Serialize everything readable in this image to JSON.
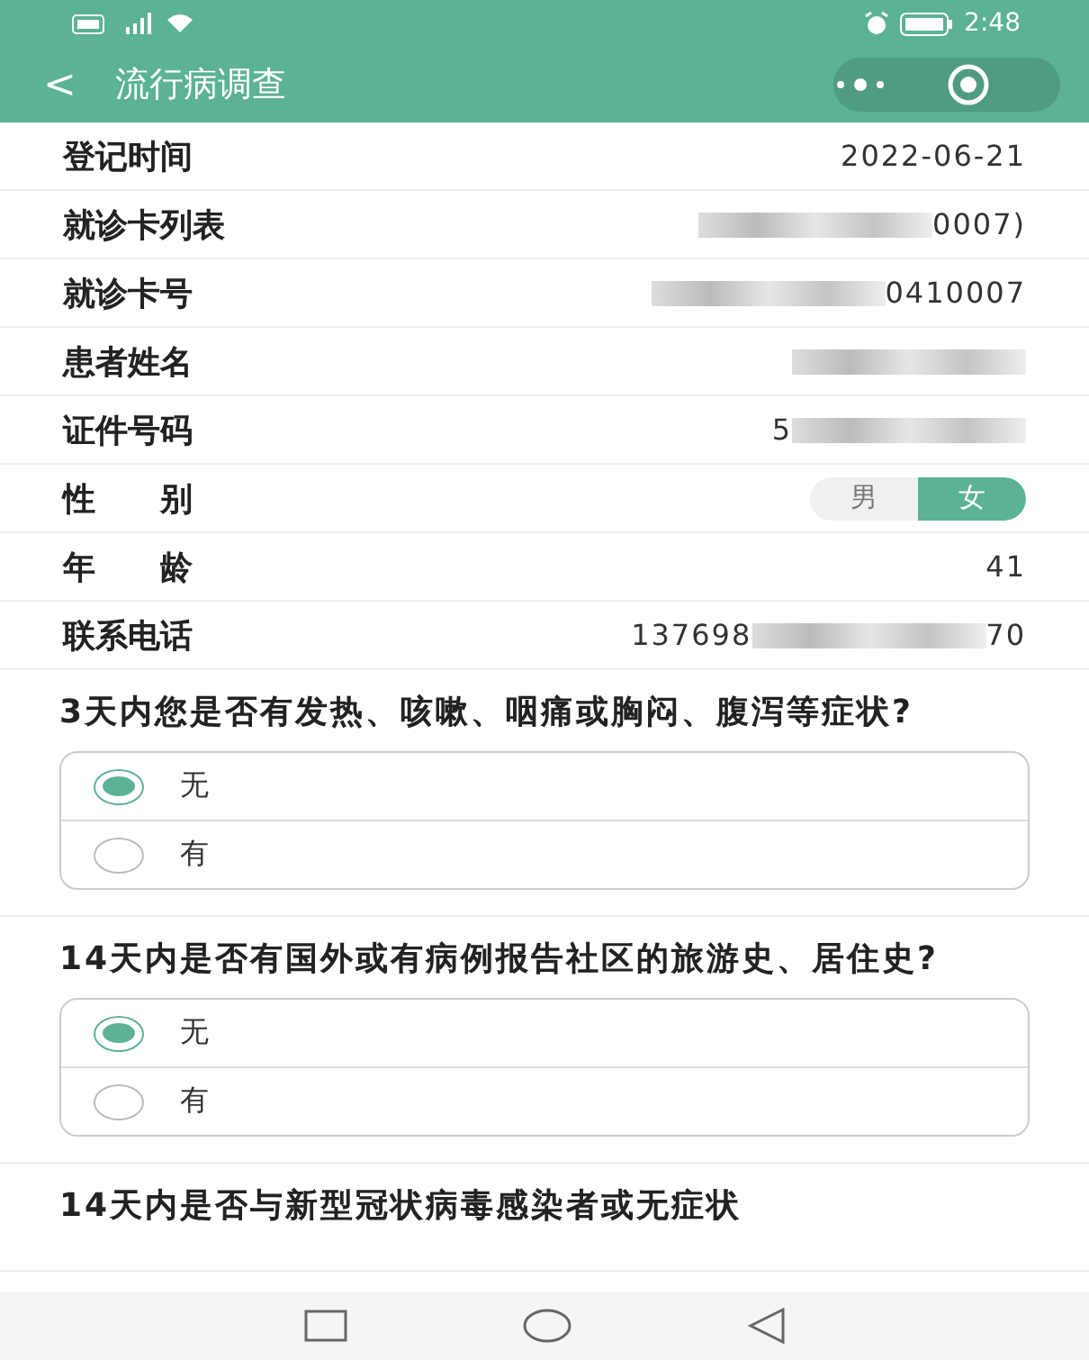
{
  "status_bar": {
    "time": "2:48"
  },
  "header": {
    "back": "<",
    "title": "流行病调查"
  },
  "fields": [
    {
      "label": "登记时间",
      "kind": "text",
      "value": [
        {
          "kind": "text",
          "text": "2022-06-21"
        }
      ]
    },
    {
      "label": "就诊卡列表",
      "kind": "text",
      "value": [
        {
          "kind": "blur"
        },
        {
          "kind": "text",
          "text": "0007)"
        }
      ]
    },
    {
      "label": "就诊卡号",
      "kind": "text",
      "value": [
        {
          "kind": "blur"
        },
        {
          "kind": "text",
          "text": "0410007"
        }
      ]
    },
    {
      "label": "患者姓名",
      "kind": "text",
      "value": [
        {
          "kind": "blur"
        }
      ]
    },
    {
      "label": "证件号码",
      "kind": "text",
      "value": [
        {
          "kind": "text",
          "text": "5"
        },
        {
          "kind": "blur"
        }
      ]
    },
    {
      "label": "性　　别",
      "kind": "toggle",
      "options": [
        {
          "label": "男",
          "selected": false
        },
        {
          "label": "女",
          "selected": true
        }
      ]
    },
    {
      "label": "年　　龄",
      "kind": "text",
      "value": [
        {
          "kind": "text",
          "text": "41"
        }
      ]
    },
    {
      "label": "联系电话",
      "kind": "text",
      "value": [
        {
          "kind": "text",
          "text": "137698"
        },
        {
          "kind": "blur"
        },
        {
          "kind": "text",
          "text": "70"
        }
      ]
    }
  ],
  "questions": [
    {
      "text": "3天内您是否有发热、咳嗽、咽痛或胸闷、腹泻等症状?",
      "options": [
        {
          "label": "无",
          "selected": true
        },
        {
          "label": "有",
          "selected": false
        }
      ]
    },
    {
      "text": "14天内是否有国外或有病例报告社区的旅游史、居住史?",
      "options": [
        {
          "label": "无",
          "selected": true
        },
        {
          "label": "有",
          "selected": false
        }
      ]
    },
    {
      "text": "14天内是否与新型冠状病毒感染者或无症状"
    }
  ]
}
